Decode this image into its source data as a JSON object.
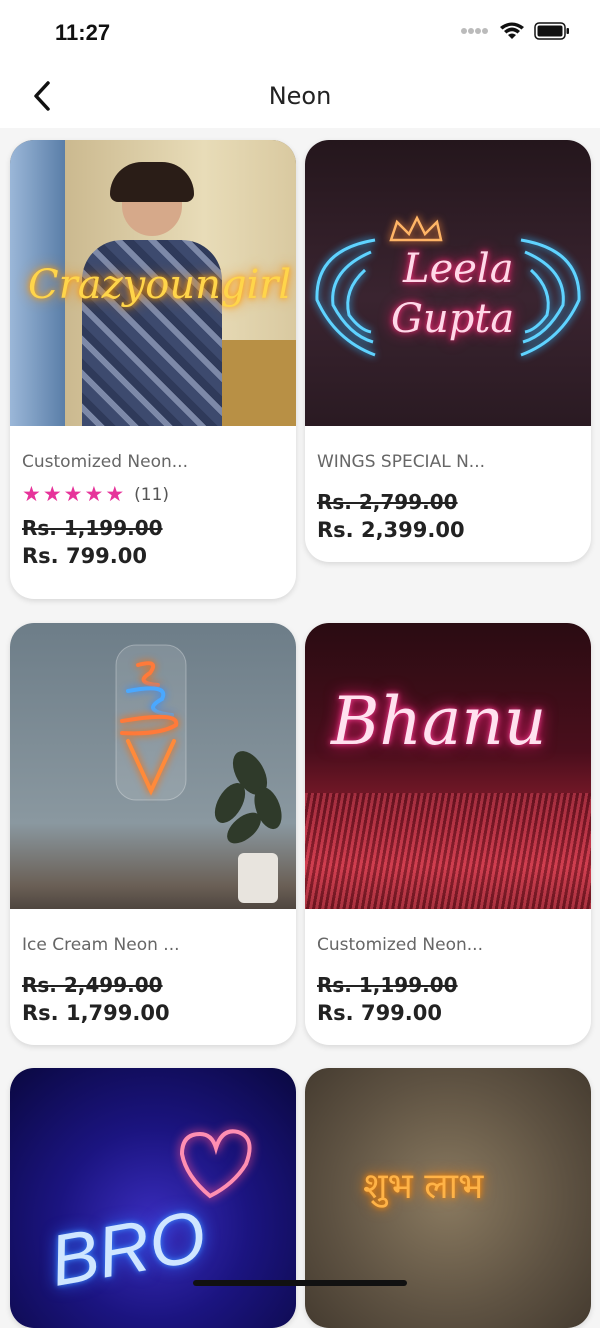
{
  "status_bar": {
    "time": "11:27"
  },
  "header": {
    "title": "Neon"
  },
  "icons": {
    "back": "chevron-left-icon",
    "wifi": "wifi-icon",
    "battery": "battery-icon",
    "signal": "signal-dots-icon",
    "star": "star-icon"
  },
  "colors": {
    "star": "#e6339a",
    "text_dark": "#222222",
    "text_muted": "#666666"
  },
  "products": [
    {
      "title": "Customized Neon...",
      "rating_count": "(11)",
      "stars": 5,
      "old_price": "Rs. 1,199.00",
      "new_price": "Rs. 799.00",
      "image_text": "Crazyoungirl"
    },
    {
      "title": "WINGS SPECIAL N...",
      "old_price": "Rs. 2,799.00",
      "new_price": "Rs. 2,399.00",
      "image_text_1": "Leela",
      "image_text_2": "Gupta"
    },
    {
      "title": "Ice Cream Neon ...",
      "old_price": "Rs. 2,499.00",
      "new_price": "Rs. 1,799.00"
    },
    {
      "title": "Customized Neon...",
      "old_price": "Rs. 1,199.00",
      "new_price": "Rs. 799.00",
      "image_text": "Bhanu"
    },
    {
      "title": "",
      "image_text": "BRO"
    },
    {
      "title": "",
      "image_text": "शुभ लाभ"
    }
  ]
}
